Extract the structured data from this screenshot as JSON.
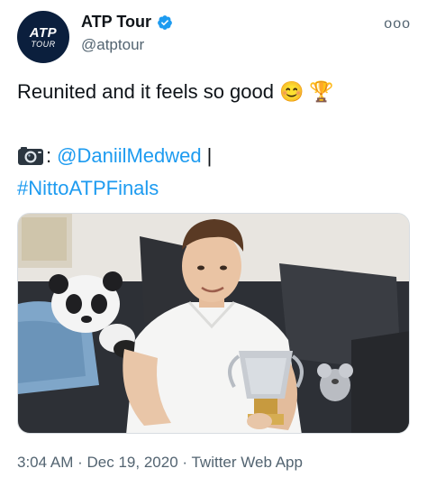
{
  "author": {
    "display_name": "ATP Tour",
    "handle": "@atptour",
    "avatar_logo": "ATP",
    "avatar_logo_sub": "TOUR",
    "verified_icon": "verified-badge-icon",
    "brand_color": "#0b1f3d",
    "verified_color": "#1d9bf0"
  },
  "more_menu": {
    "icon": "more-options-icon",
    "glyph": "ooo"
  },
  "tweet": {
    "line1": "Reunited and it feels so good",
    "emoji_smile": "😊",
    "emoji_trophy": "🏆",
    "camera_icon": "camera-icon",
    "photo_sep": ":",
    "mention": "@DaniilMedwed",
    "pipe": "|",
    "hashtag": "#NittoATPFinals",
    "link_color": "#1d9bf0"
  },
  "photo": {
    "icon": "tweet-photo"
  },
  "meta": {
    "time": "3:04 AM",
    "dot1": "·",
    "date": "Dec 19, 2020",
    "dot2": "·",
    "source": "Twitter Web App"
  }
}
